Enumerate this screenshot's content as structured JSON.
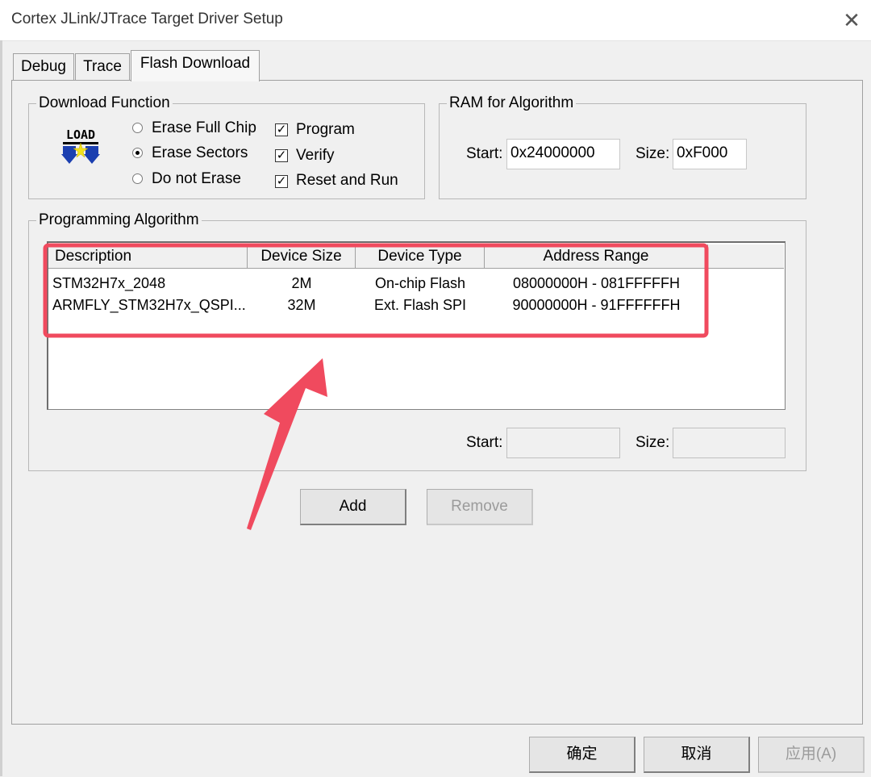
{
  "window": {
    "title": "Cortex JLink/JTrace Target Driver Setup"
  },
  "tabs": [
    {
      "label": "Debug"
    },
    {
      "label": "Trace"
    },
    {
      "label": "Flash Download"
    }
  ],
  "download_function": {
    "legend": "Download Function",
    "icon": "load-icon",
    "icon_text": "LOAD",
    "erase_options": [
      {
        "label": "Erase Full Chip",
        "selected": false
      },
      {
        "label": "Erase Sectors",
        "selected": true
      },
      {
        "label": "Do not Erase",
        "selected": false
      }
    ],
    "checkboxes": [
      {
        "label": "Program",
        "checked": true
      },
      {
        "label": "Verify",
        "checked": true
      },
      {
        "label": "Reset and Run",
        "checked": true
      }
    ]
  },
  "ram_for_algorithm": {
    "legend": "RAM for Algorithm",
    "start_label": "Start:",
    "start_value": "0x24000000",
    "size_label": "Size:",
    "size_value": "0xF000"
  },
  "programming_algorithm": {
    "legend": "Programming Algorithm",
    "columns": [
      "Description",
      "Device Size",
      "Device Type",
      "Address Range"
    ],
    "rows": [
      {
        "description": "STM32H7x_2048",
        "device_size": "2M",
        "device_type": "On-chip Flash",
        "address_range": "08000000H - 081FFFFFH"
      },
      {
        "description": "ARMFLY_STM32H7x_QSPI...",
        "device_size": "32M",
        "device_type": "Ext. Flash SPI",
        "address_range": "90000000H - 91FFFFFFH"
      }
    ],
    "start_label": "Start:",
    "start_value": "",
    "size_label": "Size:",
    "size_value": ""
  },
  "actions": {
    "add_label": "Add",
    "remove_label": "Remove"
  },
  "dialog_buttons": {
    "ok_label": "确定",
    "cancel_label": "取消",
    "apply_label": "应用(A)"
  },
  "colors": {
    "highlight": "#f04a5e",
    "window_bg": "#f0f0f0"
  }
}
